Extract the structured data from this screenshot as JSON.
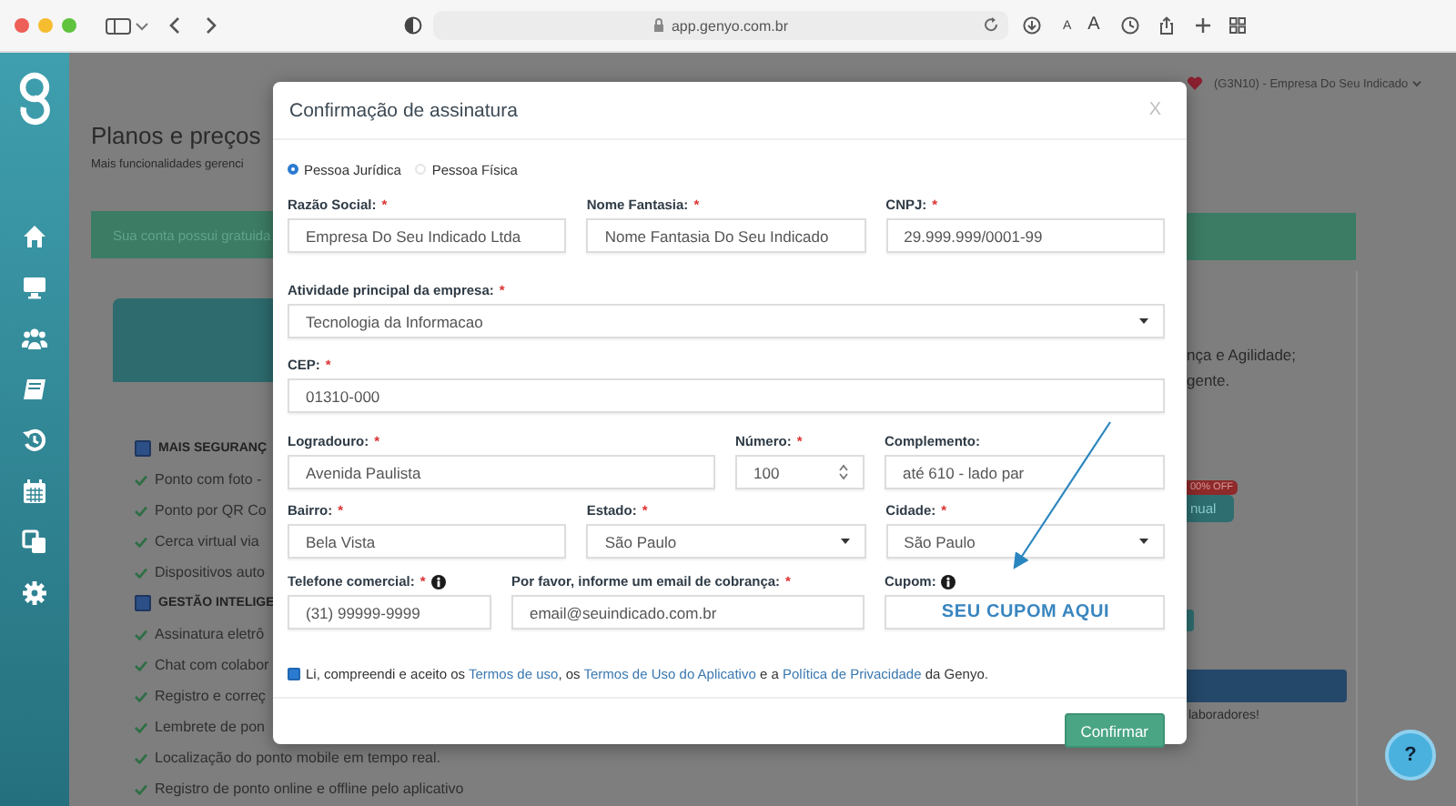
{
  "browser": {
    "url": "app.genyo.com.br",
    "text_size_buttons": [
      "A",
      "A"
    ]
  },
  "header": {
    "account": "(G3N10) - Empresa Do Seu Indicado"
  },
  "page": {
    "title": "Planos e preços",
    "subtitle": "Mais funcionalidades gerenci",
    "notice": "Sua conta possui gratuida",
    "features": [
      {
        "kind": "group",
        "label": "MAIS SEGURANÇ",
        "checked": true
      },
      {
        "kind": "item",
        "label": "Ponto com foto -"
      },
      {
        "kind": "item",
        "label": "Ponto por QR Co"
      },
      {
        "kind": "item",
        "label": "Cerca virtual via"
      },
      {
        "kind": "item",
        "label": "Dispositivos auto"
      },
      {
        "kind": "group",
        "label": "GESTÃO INTELIGE",
        "checked": true
      },
      {
        "kind": "item",
        "label": "Assinatura eletrô"
      },
      {
        "kind": "item",
        "label": "Chat com colabor"
      },
      {
        "kind": "item",
        "label": "Registro e correç"
      },
      {
        "kind": "item",
        "label": "Lembrete de pon"
      },
      {
        "kind": "item",
        "label": "Localização do ponto mobile em tempo real."
      },
      {
        "kind": "item",
        "label": "Registro de ponto online e offline pelo aplicativo"
      }
    ],
    "right_lines": [
      "nça e Agilidade;",
      "gente."
    ],
    "discount_badge": "00% OFF",
    "plan_button": "nual",
    "footer_note": "laboradores!"
  },
  "help_button": "?",
  "modal": {
    "title": "Confirmação de assinatura",
    "close": "X",
    "person_types": [
      {
        "label": "Pessoa Jurídica",
        "selected": true
      },
      {
        "label": "Pessoa Física",
        "selected": false
      }
    ],
    "rows": [
      [
        {
          "label": "Razão Social:",
          "required_mark": "*",
          "kind": "text",
          "value": "Empresa Do Seu Indicado Ltda"
        },
        {
          "label": "Nome Fantasia:",
          "required_mark": "*",
          "kind": "text",
          "value": "Nome Fantasia Do Seu Indicado"
        },
        {
          "label": "CNPJ:",
          "required_mark": "*",
          "kind": "text",
          "value": "29.999.999/0001-99"
        }
      ],
      [
        {
          "label": "Atividade principal da empresa:",
          "required_mark": "*",
          "kind": "select",
          "value": "Tecnologia da Informacao"
        }
      ],
      [
        {
          "label": "CEP:",
          "required_mark": "*",
          "kind": "text",
          "value": "01310-000"
        }
      ],
      [
        {
          "label": "Logradouro:",
          "required_mark": "*",
          "kind": "text",
          "value": "Avenida Paulista"
        },
        {
          "label": "Número:",
          "required_mark": "*",
          "kind": "number",
          "value": "100"
        },
        {
          "label": "Complemento:",
          "kind": "text",
          "value": "até 610 - lado par"
        }
      ],
      [
        {
          "label": "Bairro:",
          "required_mark": "*",
          "kind": "text",
          "value": "Bela Vista"
        },
        {
          "label": "Estado:",
          "required_mark": "*",
          "kind": "select",
          "value": "São Paulo"
        },
        {
          "label": "Cidade:",
          "required_mark": "*",
          "kind": "select",
          "value": "São Paulo"
        }
      ],
      [
        {
          "label": "Telefone comercial:",
          "required_mark": "*",
          "info": true,
          "kind": "text",
          "value": "(31) 99999-9999"
        },
        {
          "label": "Por favor, informe um email de cobrança:",
          "required_mark": "*",
          "kind": "text",
          "value": "email@seuindicado.com.br"
        },
        {
          "label": "Cupom:",
          "info": true,
          "kind": "coupon",
          "value": "SEU CUPOM AQUI"
        }
      ]
    ],
    "terms": {
      "checked": true,
      "parts": [
        {
          "text": "Li, compreendi e aceito os ",
          "link": false
        },
        {
          "text": "Termos de uso",
          "link": true
        },
        {
          "text": ", os ",
          "link": false
        },
        {
          "text": "Termos de Uso do Aplicativo",
          "link": true
        },
        {
          "text": " e a ",
          "link": false
        },
        {
          "text": "Política de Privacidade",
          "link": true
        },
        {
          "text": " da Genyo.",
          "link": false
        }
      ]
    },
    "confirm": "Confirmar"
  }
}
